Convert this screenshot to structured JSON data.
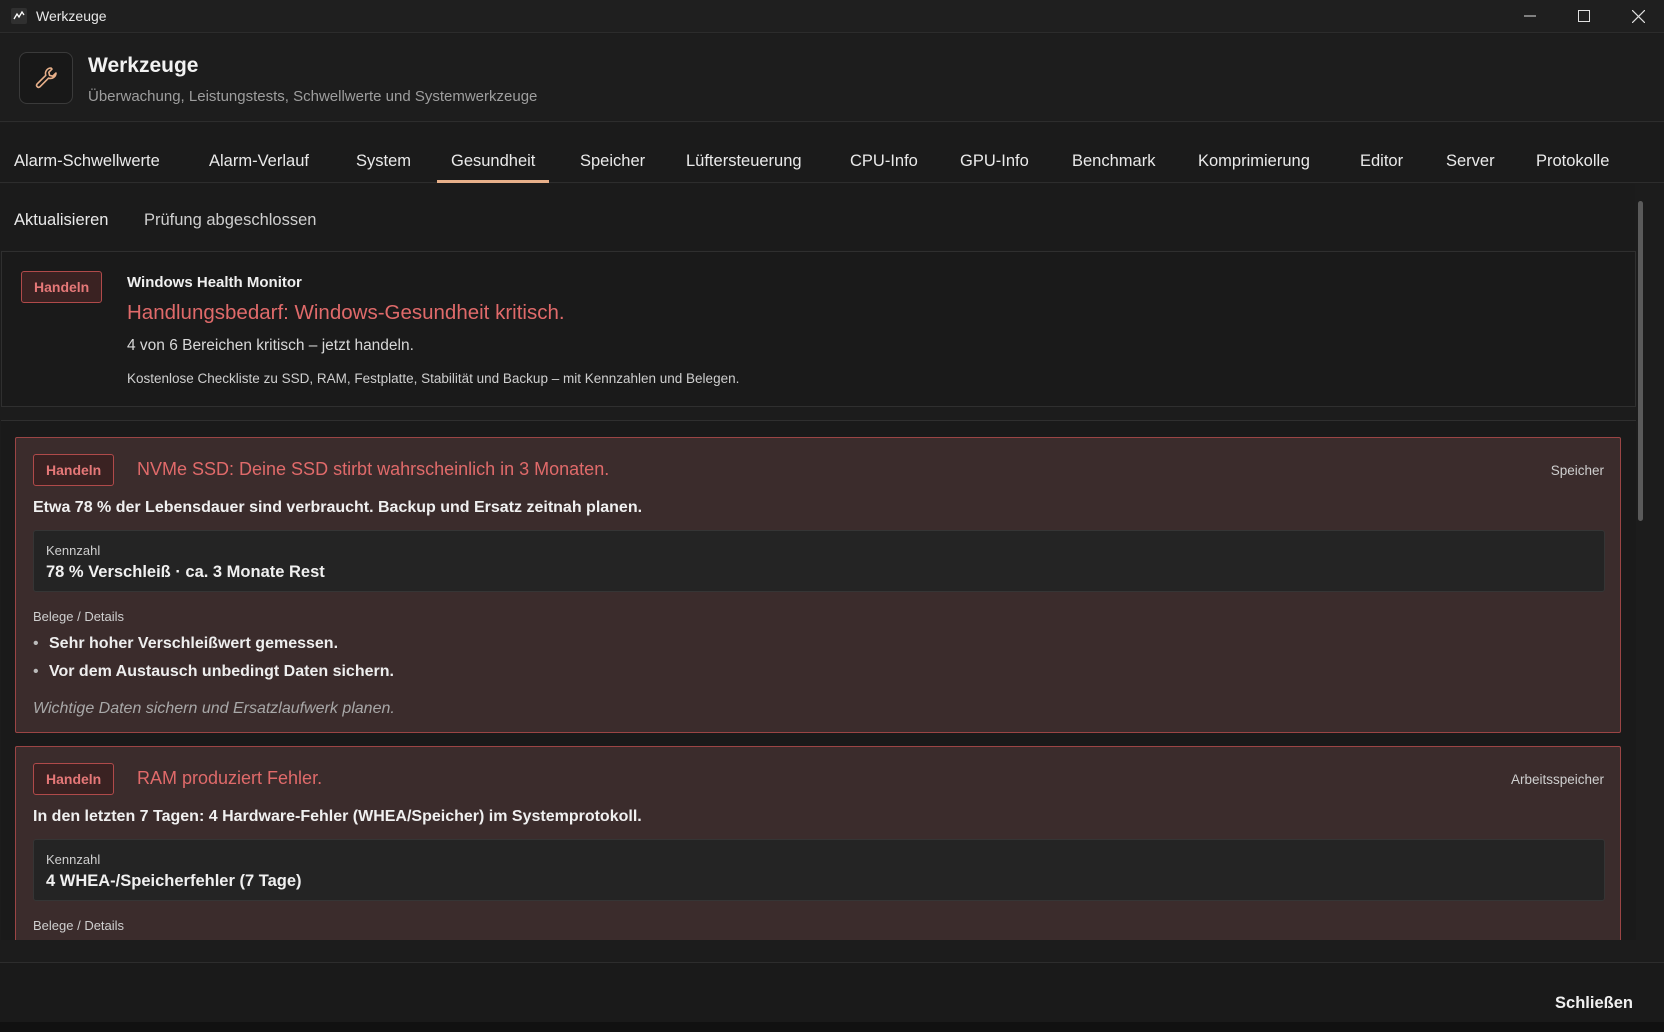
{
  "window": {
    "title": "Werkzeuge",
    "minimize_icon": "minimize-icon",
    "maximize_icon": "maximize-icon",
    "close_icon": "close-icon"
  },
  "header": {
    "icon": "wrench-icon",
    "title": "Werkzeuge",
    "subtitle": "Überwachung, Leistungstests, Schwellwerte und Systemwerkzeuge"
  },
  "tabs": [
    {
      "label": "Alarm-Schwellwerte"
    },
    {
      "label": "Alarm-Verlauf"
    },
    {
      "label": "System"
    },
    {
      "label": "Gesundheit",
      "active": true
    },
    {
      "label": "Speicher"
    },
    {
      "label": "Lüftersteuerung"
    },
    {
      "label": "CPU-Info"
    },
    {
      "label": "GPU-Info"
    },
    {
      "label": "Benchmark"
    },
    {
      "label": "Komprimierung"
    },
    {
      "label": "Editor"
    },
    {
      "label": "Server"
    },
    {
      "label": "Protokolle"
    }
  ],
  "toolbar": {
    "refresh_label": "Aktualisieren",
    "status": "Prüfung abgeschlossen"
  },
  "summary": {
    "badge": "Handeln",
    "app_name": "Windows Health Monitor",
    "headline": "Handlungsbedarf: Windows-Gesundheit kritisch.",
    "count_text": "4 von 6 Bereichen kritisch – jetzt handeln.",
    "description": "Kostenlose Checkliste zu SSD, RAM, Festplatte, Stabilität und Backup – mit Kennzahlen und Belegen."
  },
  "issues": [
    {
      "badge": "Handeln",
      "title": "NVMe SSD: Deine SSD stirbt wahrscheinlich in 3 Monaten.",
      "category": "Speicher",
      "summary": "Etwa 78 % der Lebensdauer sind verbraucht. Backup und Ersatz zeitnah planen.",
      "metric_label": "Kennzahl",
      "metric_value": "78 % Verschleiß · ca. 3 Monate Rest",
      "details_label": "Belege / Details",
      "details": [
        "Sehr hoher Verschleißwert gemessen.",
        "Vor dem Austausch unbedingt Daten sichern."
      ],
      "recommendation": "Wichtige Daten sichern und Ersatzlaufwerk planen."
    },
    {
      "badge": "Handeln",
      "title": "RAM produziert Fehler.",
      "category": "Arbeitsspeicher",
      "summary": "In den letzten 7 Tagen: 4 Hardware-Fehler (WHEA/Speicher) im Systemprotokoll.",
      "metric_label": "Kennzahl",
      "metric_value": "4 WHEA-/Speicherfehler (7 Tage)",
      "details_label": "Belege / Details"
    }
  ],
  "footer": {
    "close_label": "Schließen"
  },
  "colors": {
    "accent_tab_underline": "#e8b08a",
    "critical_text": "#e06a6a",
    "critical_border": "#9b4545",
    "critical_card_bg": "#3b2c2c"
  }
}
